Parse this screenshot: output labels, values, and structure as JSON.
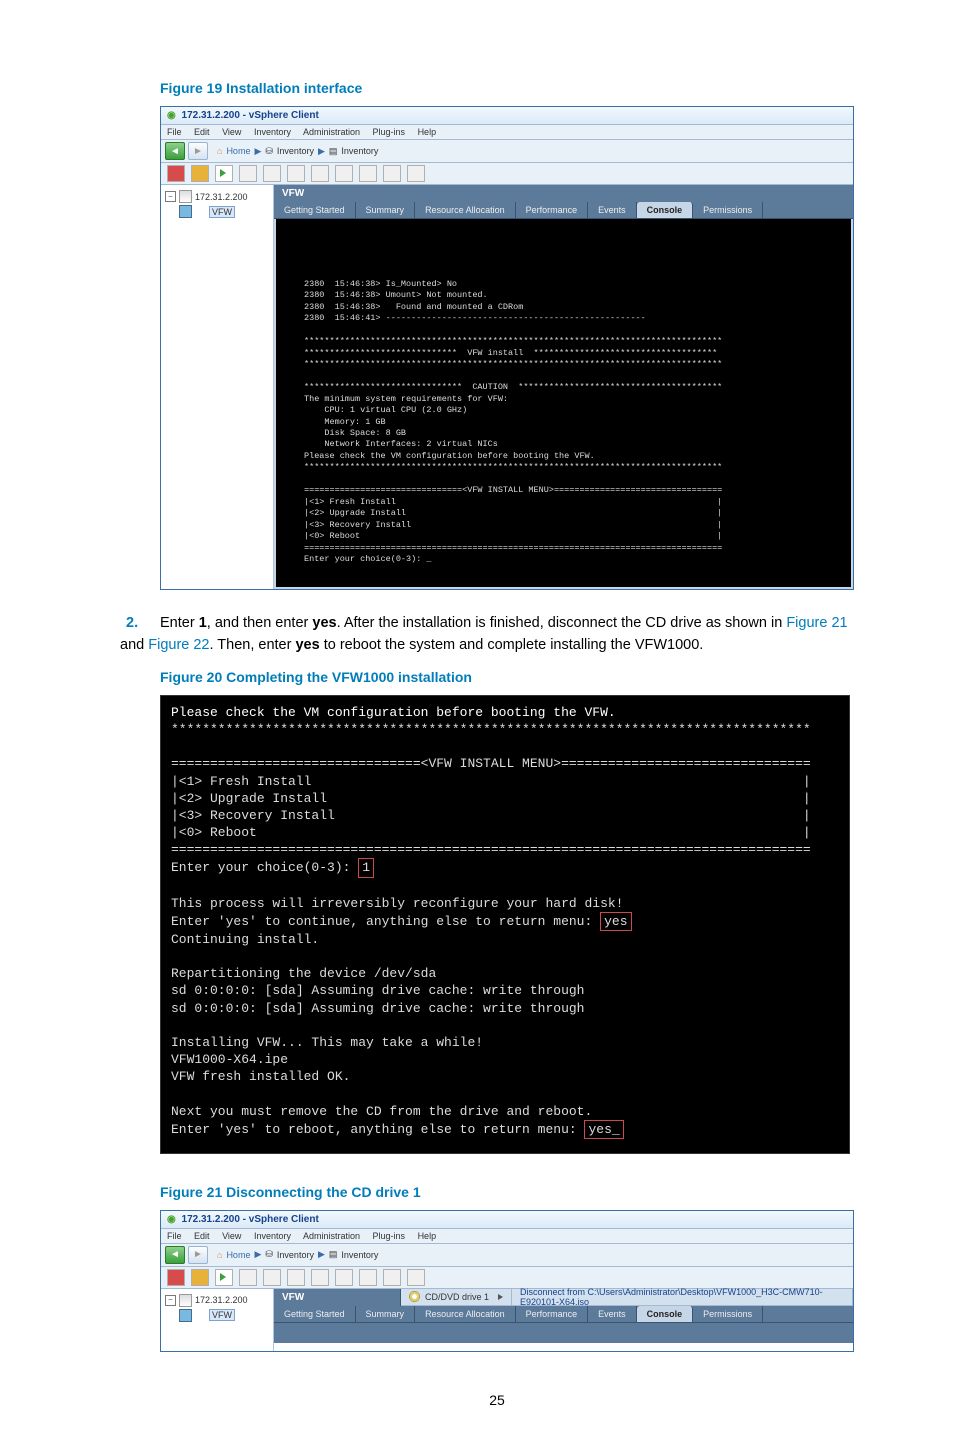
{
  "captions": {
    "fig19": "Figure 19 Installation interface",
    "fig20": "Figure 20 Completing the VFW1000 installation",
    "fig21": "Figure 21 Disconnecting the CD drive 1"
  },
  "step2": {
    "num": "2.",
    "text_a": "Enter ",
    "bold_a": "1",
    "text_b": ", and then enter ",
    "bold_b": "yes",
    "text_c": ". After the installation is finished, disconnect the CD drive as shown in ",
    "link1": "Figure 21",
    "text_d": " and ",
    "link2": "Figure 22",
    "text_e": ". Then, enter ",
    "bold_c": "yes",
    "text_f": " to reboot the system and complete installing the VFW1000."
  },
  "vsphere": {
    "title": "172.31.2.200 - vSphere Client",
    "menus": [
      "File",
      "Edit",
      "View",
      "Inventory",
      "Administration",
      "Plug-ins",
      "Help"
    ],
    "bc_home": "Home",
    "bc_inv": "Inventory",
    "bc_inv2": "Inventory",
    "tree_ip": "172.31.2.200",
    "tree_vfw": "VFW",
    "panel_title": "VFW",
    "tabs": [
      "Getting Started",
      "Summary",
      "Resource Allocation",
      "Performance",
      "Events",
      "Console",
      "Permissions"
    ]
  },
  "console19": "\n\n\n\n2380  15:46:38> Is_Mounted> No\n2380  15:46:38> Umount> Not mounted.\n2380  15:46:38>   Found and mounted a CDRom\n2380  15:46:41> ---------------------------------------------------\n\n**********************************************************************************\n******************************  VFW install  ************************************\n**********************************************************************************\n\n*******************************  CAUTION  ****************************************\nThe minimum system requirements for VFW:\n    CPU: 1 virtual CPU (2.0 GHz)\n    Memory: 1 GB\n    Disk Space: 8 GB\n    Network Interfaces: 2 virtual NICs\nPlease check the VM configuration before booting the VFW.\n**********************************************************************************\n\n===============================<VFW INSTALL MENU>=================================\n|<1> Fresh Install                                                               |\n|<2> Upgrade Install                                                             |\n|<3> Recovery Install                                                            |\n|<0> Reboot                                                                      |\n==================================================================================\nEnter your choice(0-3): _",
  "console20": {
    "top": "Please check the VM configuration before booting the VFW.",
    "stars": "**********************************************************************************",
    "menuhdr": "================================<VFW INSTALL MENU>================================",
    "m1": "|<1> Fresh Install                                                               |",
    "m2": "|<2> Upgrade Install                                                             |",
    "m3": "|<3> Recovery Install                                                            |",
    "m4": "|<0> Reboot                                                                      |",
    "menuend": "==================================================================================",
    "prompt": "Enter your choice(0-3):",
    "input1": "1",
    "l1": "This process will irreversibly reconfigure your hard disk!",
    "l2a": "Enter 'yes' to continue, anything else to return menu:",
    "input2": "yes",
    "l3": "Continuing install.",
    "l4": "Repartitioning the device /dev/sda",
    "l5": "sd 0:0:0:0: [sda] Assuming drive cache: write through",
    "l6": "sd 0:0:0:0: [sda] Assuming drive cache: write through",
    "l7": "Installing VFW... This may take a while!",
    "l8": "VFW1000-X64.ipe",
    "l9": "VFW fresh installed OK.",
    "l10": "Next you must remove the CD from the drive and reboot.",
    "l11a": "Enter 'yes' to reboot, anything else to return menu:",
    "input3": "yes_"
  },
  "fig21bar": {
    "drive": "CD/DVD drive 1",
    "disconnect": "Disconnect from C:\\Users\\Administrator\\Desktop\\VFW1000_H3C-CMW710-E920101-X64.iso"
  },
  "page_number": "25"
}
